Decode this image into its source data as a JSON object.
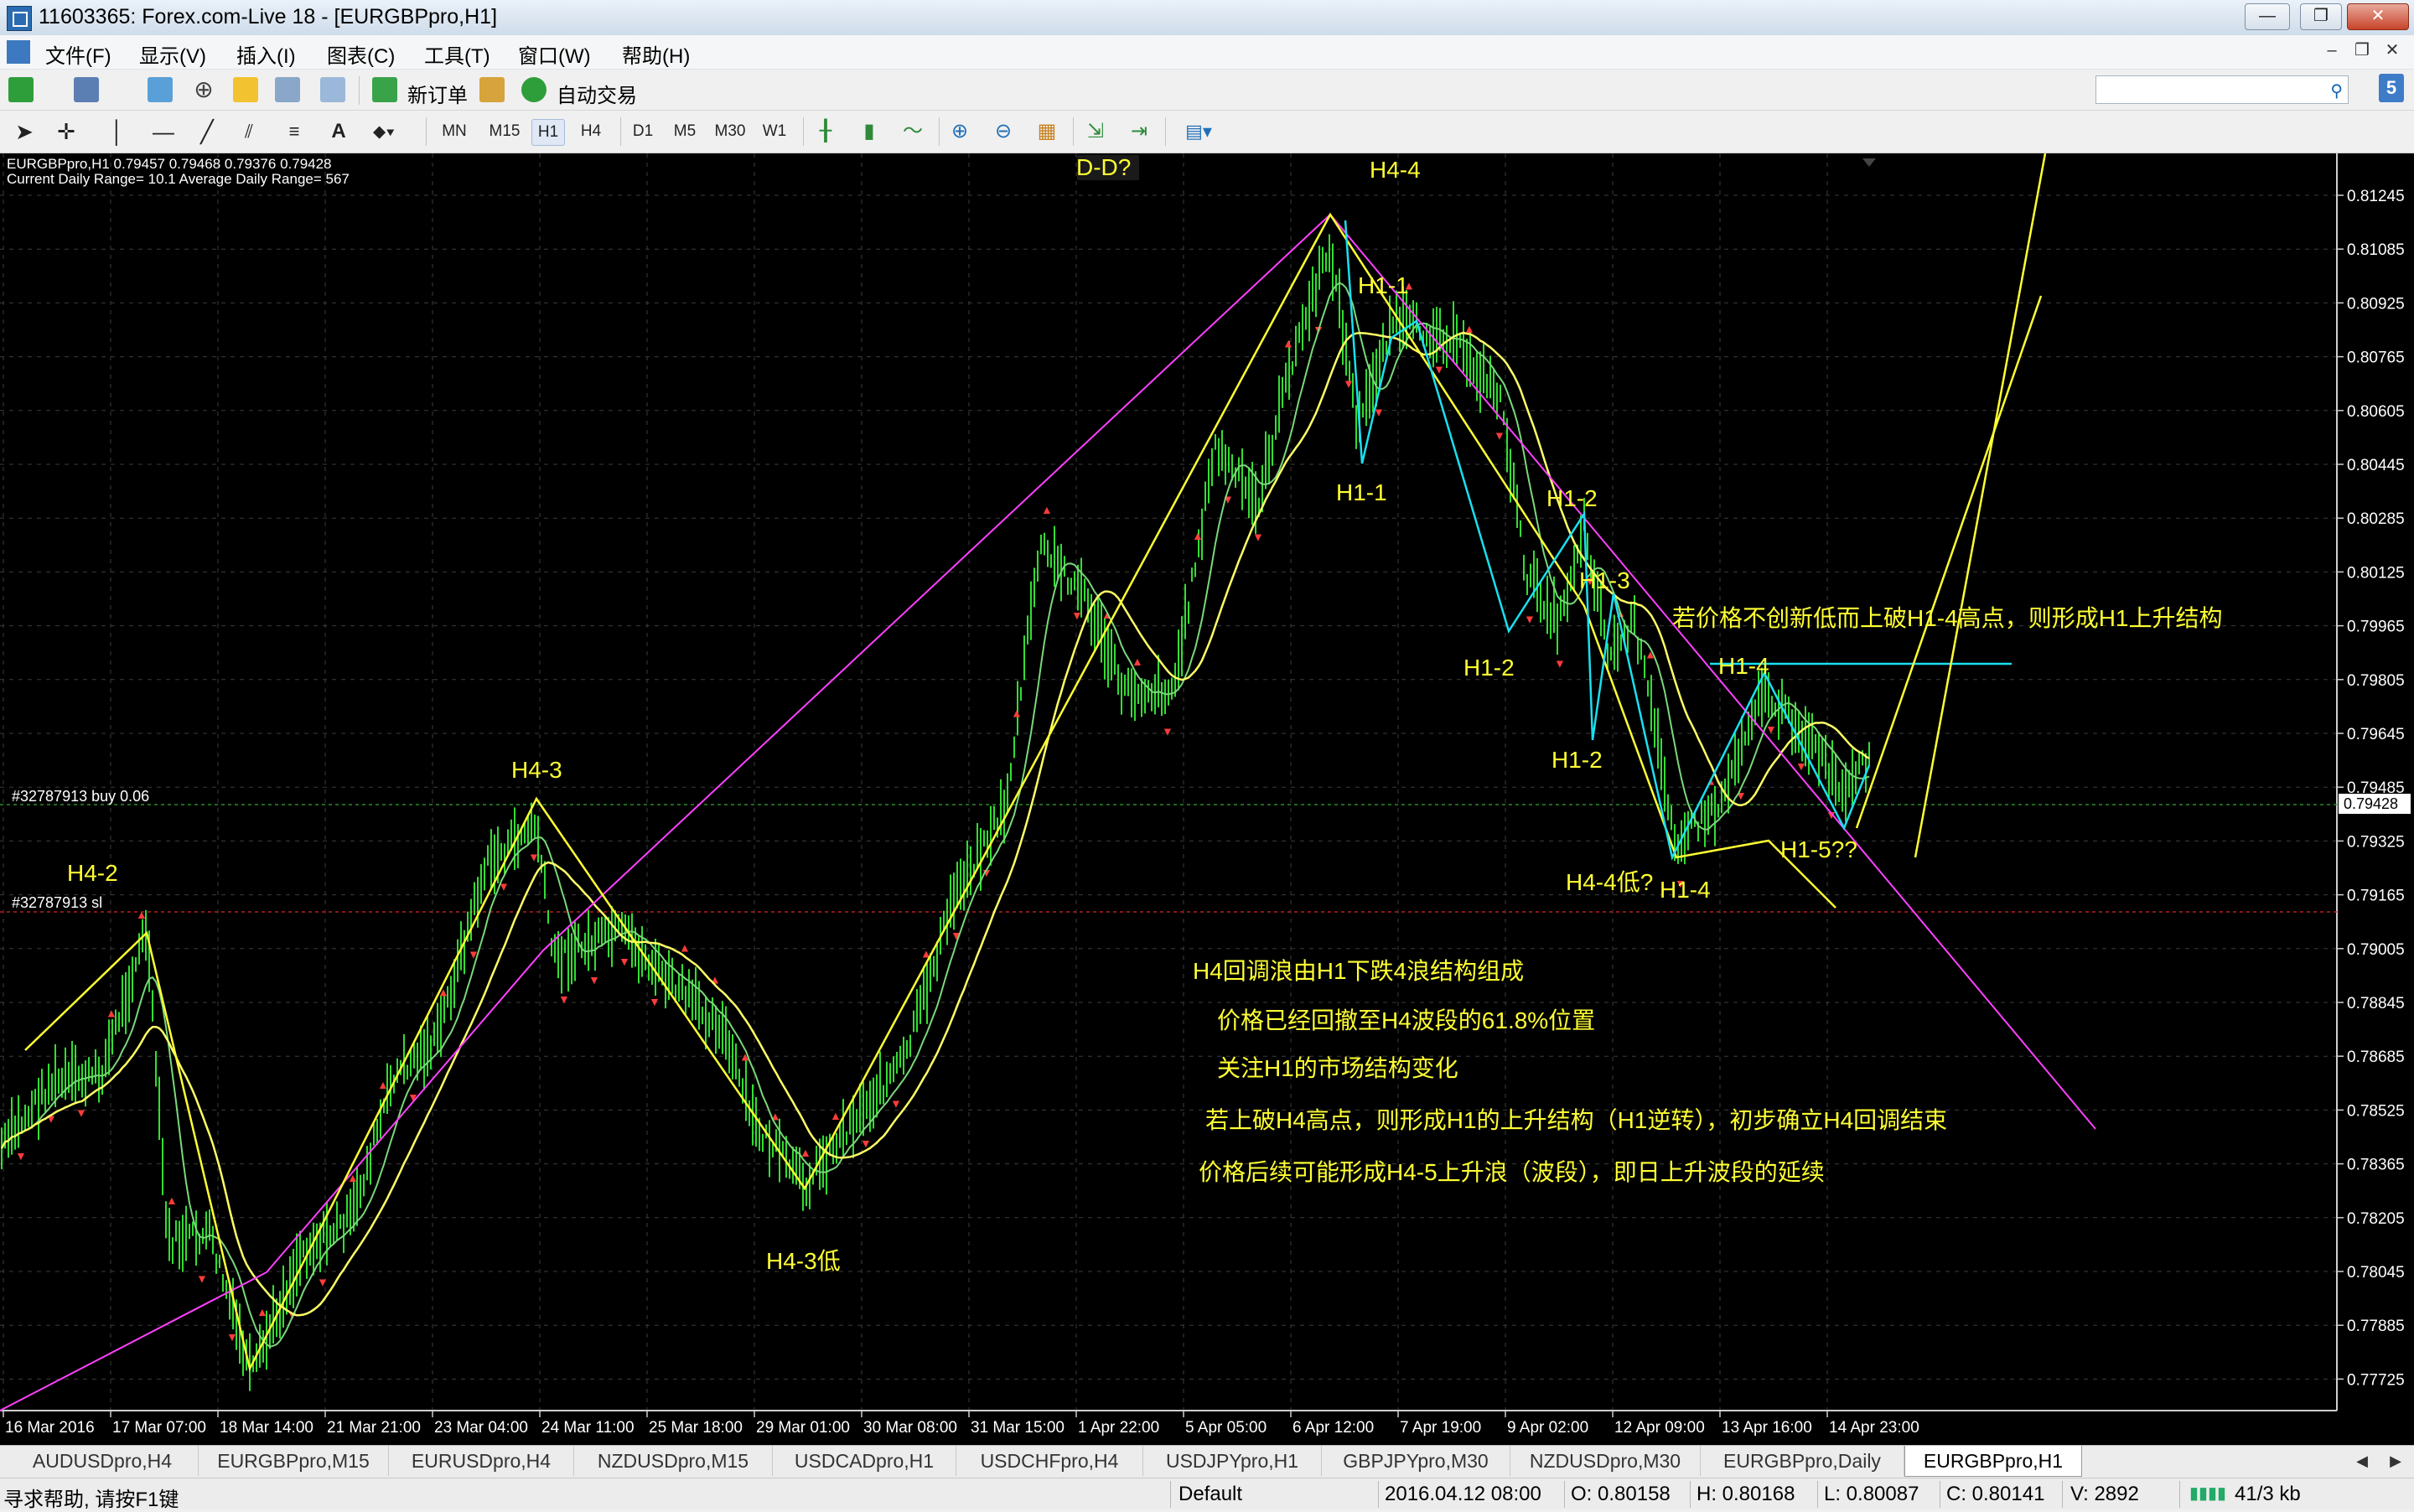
{
  "window": {
    "title": "11603365: Forex.com-Live 18 - [EURGBPpro,H1]",
    "min_label": "—",
    "restore_label": "❐",
    "close_label": "✕"
  },
  "menu": [
    "文件(F)",
    "显示(V)",
    "插入(I)",
    "图表(C)",
    "工具(T)",
    "窗口(W)",
    "帮助(H)"
  ],
  "toolbar1": {
    "new_order_label": "新订单",
    "auto_trading_label": "自动交易",
    "search_placeholder": "",
    "help_label": "5"
  },
  "toolbar2": {
    "timeframes": [
      "MN",
      "M15",
      "H1",
      "H4",
      "D1",
      "M5",
      "M30",
      "W1"
    ],
    "active_timeframe": "H1",
    "text_tool": "A"
  },
  "chart": {
    "info_line1": "EURGBPpro,H1  0.79457 0.79468 0.79376 0.79428",
    "info_line2": "Current Daily Range= 10.1    Average Daily Range= 567",
    "order_buy_label": "#32787913 buy 0.06",
    "order_sl_label": "#32787913 sl",
    "current_price": "0.79428",
    "price_ticks": [
      "0.81245",
      "0.81085",
      "0.80925",
      "0.80765",
      "0.80605",
      "0.80445",
      "0.80285",
      "0.80125",
      "0.79965",
      "0.79805",
      "0.79645",
      "0.79485",
      "0.79325",
      "0.79165",
      "0.79005",
      "0.78845",
      "0.78685",
      "0.78525",
      "0.78365",
      "0.78205",
      "0.78045",
      "0.77885",
      "0.77725"
    ],
    "time_ticks": [
      "16 Mar 2016",
      "17 Mar 07:00",
      "18 Mar 14:00",
      "21 Mar 21:00",
      "23 Mar 04:00",
      "24 Mar 11:00",
      "25 Mar 18:00",
      "29 Mar 01:00",
      "30 Mar 08:00",
      "31 Mar 15:00",
      "1 Apr 22:00",
      "5 Apr 05:00",
      "6 Apr 12:00",
      "7 Apr 19:00",
      "9 Apr 02:00",
      "12 Apr 09:00",
      "13 Apr 16:00",
      "14 Apr 23:00"
    ],
    "wave_labels": [
      "D-D?",
      "H4-4",
      "H1-1",
      "H1-1",
      "H1-2",
      "H1-3",
      "H1-2",
      "H1-2",
      "H1-4",
      "H4-4低?",
      "H1-4",
      "H1-5??",
      "H4-3",
      "H4-2",
      "H4-3低"
    ],
    "annotations": [
      "若价格不创新低而上破H1-4高点，则形成H1上升结构",
      "H4回调浪由H1下跌4浪结构组成",
      "价格已经回撤至H4波段的61.8%位置",
      "关注H1的市场结构变化",
      "若上破H4高点，则形成H1的上升结构（H1逆转），初步确立H4回调结束",
      "价格后续可能形成H4-5上升浪（波段），即日上升波段的延续"
    ]
  },
  "tabs": [
    "AUDUSDpro,H4",
    "EURGBPpro,M15",
    "EURUSDpro,H4",
    "NZDUSDpro,M15",
    "USDCADpro,H1",
    "USDCHFpro,H4",
    "USDJPYpro,H1",
    "GBPJPYpro,M30",
    "NZDUSDpro,M30",
    "EURGBPpro,Daily",
    "EURGBPpro,H1"
  ],
  "active_tab": "EURGBPpro,H1",
  "status": {
    "help": "寻求帮助, 请按F1键",
    "profile": "Default",
    "datetime": "2016.04.12 08:00",
    "open": "O: 0.80158",
    "high": "H: 0.80168",
    "low": "L: 0.80087",
    "close": "C: 0.80141",
    "volume": "V: 2892",
    "traffic": "41/3 kb"
  }
}
